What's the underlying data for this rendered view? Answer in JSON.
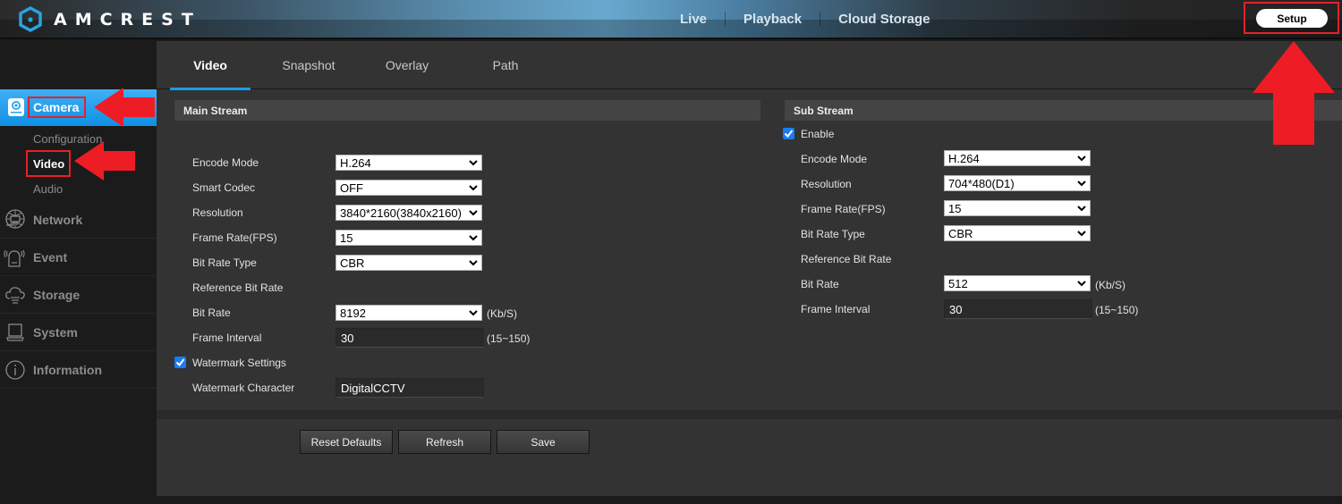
{
  "header": {
    "brand": "AMCREST",
    "nav": [
      {
        "label": "Live"
      },
      {
        "label": "Playback"
      },
      {
        "label": "Cloud Storage"
      }
    ],
    "setup_label": "Setup"
  },
  "sidebar": {
    "active": {
      "label": "Camera",
      "icon": "camera-icon"
    },
    "sub_items": [
      {
        "label": "Configuration",
        "active": false
      },
      {
        "label": "Video",
        "active": true
      },
      {
        "label": "Audio",
        "active": false
      }
    ],
    "items": [
      {
        "label": "Network",
        "icon": "network-icon"
      },
      {
        "label": "Event",
        "icon": "alarm-icon"
      },
      {
        "label": "Storage",
        "icon": "cloud-storage-icon"
      },
      {
        "label": "System",
        "icon": "laptop-icon"
      },
      {
        "label": "Information",
        "icon": "info-icon"
      }
    ]
  },
  "tabs": [
    {
      "label": "Video",
      "active": true
    },
    {
      "label": "Snapshot",
      "active": false
    },
    {
      "label": "Overlay",
      "active": false
    },
    {
      "label": "Path",
      "active": false
    }
  ],
  "main_stream": {
    "title": "Main Stream",
    "encode_mode": {
      "label": "Encode Mode",
      "value": "H.264"
    },
    "smart_codec": {
      "label": "Smart Codec",
      "value": "OFF"
    },
    "resolution": {
      "label": "Resolution",
      "value": "3840*2160(3840x2160)"
    },
    "frame_rate": {
      "label": "Frame Rate(FPS)",
      "value": "15"
    },
    "bit_rate_type": {
      "label": "Bit Rate Type",
      "value": "CBR"
    },
    "reference_bit_rate": {
      "label": "Reference Bit Rate"
    },
    "bit_rate": {
      "label": "Bit Rate",
      "value": "8192",
      "unit": "(Kb/S)"
    },
    "frame_interval": {
      "label": "Frame Interval",
      "value": "30",
      "range": "(15~150)"
    },
    "watermark_settings": {
      "label": "Watermark Settings",
      "checked": true
    },
    "watermark_character": {
      "label": "Watermark Character",
      "value": "DigitalCCTV"
    }
  },
  "sub_stream": {
    "title": "Sub Stream",
    "enable": {
      "label": "Enable",
      "checked": true
    },
    "encode_mode": {
      "label": "Encode Mode",
      "value": "H.264"
    },
    "resolution": {
      "label": "Resolution",
      "value": "704*480(D1)"
    },
    "frame_rate": {
      "label": "Frame Rate(FPS)",
      "value": "15"
    },
    "bit_rate_type": {
      "label": "Bit Rate Type",
      "value": "CBR"
    },
    "reference_bit_rate": {
      "label": "Reference Bit Rate"
    },
    "bit_rate": {
      "label": "Bit Rate",
      "value": "512",
      "unit": "(Kb/S)"
    },
    "frame_interval": {
      "label": "Frame Interval",
      "value": "30",
      "range": "(15~150)"
    }
  },
  "actions": {
    "reset_label": "Reset Defaults",
    "refresh_label": "Refresh",
    "save_label": "Save"
  },
  "colors": {
    "accent": "#1a9bea",
    "annotation": "#e5202a",
    "checkbox": "#1a7cf0"
  }
}
